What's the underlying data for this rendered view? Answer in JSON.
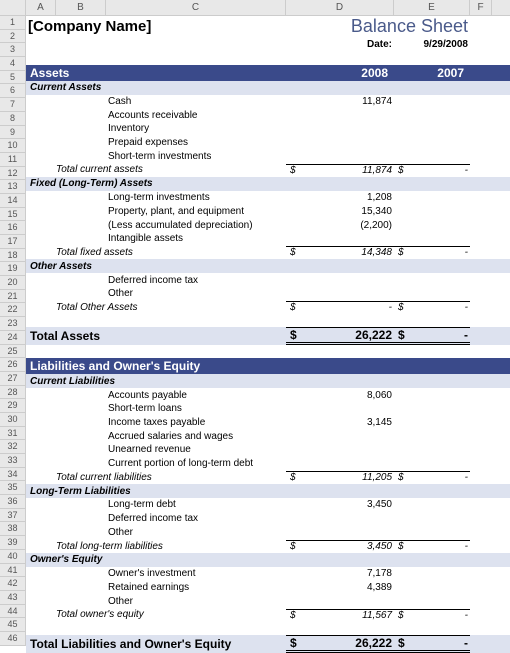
{
  "columns": [
    "A",
    "B",
    "C",
    "D",
    "E",
    "F"
  ],
  "rows": 46,
  "header": {
    "company": "[Company Name]",
    "title": "Balance Sheet",
    "date_label": "Date:",
    "date_value": "9/29/2008"
  },
  "assets": {
    "title": "Assets",
    "year1": "2008",
    "year2": "2007",
    "current": {
      "title": "Current Assets",
      "items": [
        {
          "label": "Cash",
          "v1": "11,874",
          "v2": ""
        },
        {
          "label": "Accounts receivable",
          "v1": "",
          "v2": ""
        },
        {
          "label": "Inventory",
          "v1": "",
          "v2": ""
        },
        {
          "label": "Prepaid expenses",
          "v1": "",
          "v2": ""
        },
        {
          "label": "Short-term investments",
          "v1": "",
          "v2": ""
        }
      ],
      "total_label": "Total current assets",
      "total_v1": "11,874",
      "total_v2": "-"
    },
    "fixed": {
      "title": "Fixed (Long-Term) Assets",
      "items": [
        {
          "label": "Long-term investments",
          "v1": "1,208",
          "v2": ""
        },
        {
          "label": "Property, plant, and equipment",
          "v1": "15,340",
          "v2": ""
        },
        {
          "label": "(Less accumulated depreciation)",
          "v1": "(2,200)",
          "v2": ""
        },
        {
          "label": "Intangible assets",
          "v1": "",
          "v2": ""
        }
      ],
      "total_label": "Total fixed assets",
      "total_v1": "14,348",
      "total_v2": "-"
    },
    "other": {
      "title": "Other Assets",
      "items": [
        {
          "label": "Deferred income tax",
          "v1": "",
          "v2": ""
        },
        {
          "label": "Other",
          "v1": "",
          "v2": ""
        }
      ],
      "total_label": "Total Other Assets",
      "total_v1": "-",
      "total_v2": "-"
    },
    "grand_label": "Total Assets",
    "grand_v1": "26,222",
    "grand_v2": "-"
  },
  "liab": {
    "title": "Liabilities and Owner's Equity",
    "current": {
      "title": "Current Liabilities",
      "items": [
        {
          "label": "Accounts payable",
          "v1": "8,060",
          "v2": ""
        },
        {
          "label": "Short-term loans",
          "v1": "",
          "v2": ""
        },
        {
          "label": "Income taxes payable",
          "v1": "3,145",
          "v2": ""
        },
        {
          "label": "Accrued salaries and wages",
          "v1": "",
          "v2": ""
        },
        {
          "label": "Unearned revenue",
          "v1": "",
          "v2": ""
        },
        {
          "label": "Current portion of long-term debt",
          "v1": "",
          "v2": ""
        }
      ],
      "total_label": "Total current liabilities",
      "total_v1": "11,205",
      "total_v2": "-"
    },
    "longterm": {
      "title": "Long-Term Liabilities",
      "items": [
        {
          "label": "Long-term debt",
          "v1": "3,450",
          "v2": ""
        },
        {
          "label": "Deferred income tax",
          "v1": "",
          "v2": ""
        },
        {
          "label": "Other",
          "v1": "",
          "v2": ""
        }
      ],
      "total_label": "Total long-term liabilities",
      "total_v1": "3,450",
      "total_v2": "-"
    },
    "equity": {
      "title": "Owner's Equity",
      "items": [
        {
          "label": "Owner's investment",
          "v1": "7,178",
          "v2": ""
        },
        {
          "label": "Retained earnings",
          "v1": "4,389",
          "v2": ""
        },
        {
          "label": "Other",
          "v1": "",
          "v2": ""
        }
      ],
      "total_label": "Total owner's equity",
      "total_v1": "11,567",
      "total_v2": "-"
    },
    "grand_label": "Total Liabilities and Owner's Equity",
    "grand_v1": "26,222",
    "grand_v2": "-"
  },
  "currency": "$"
}
